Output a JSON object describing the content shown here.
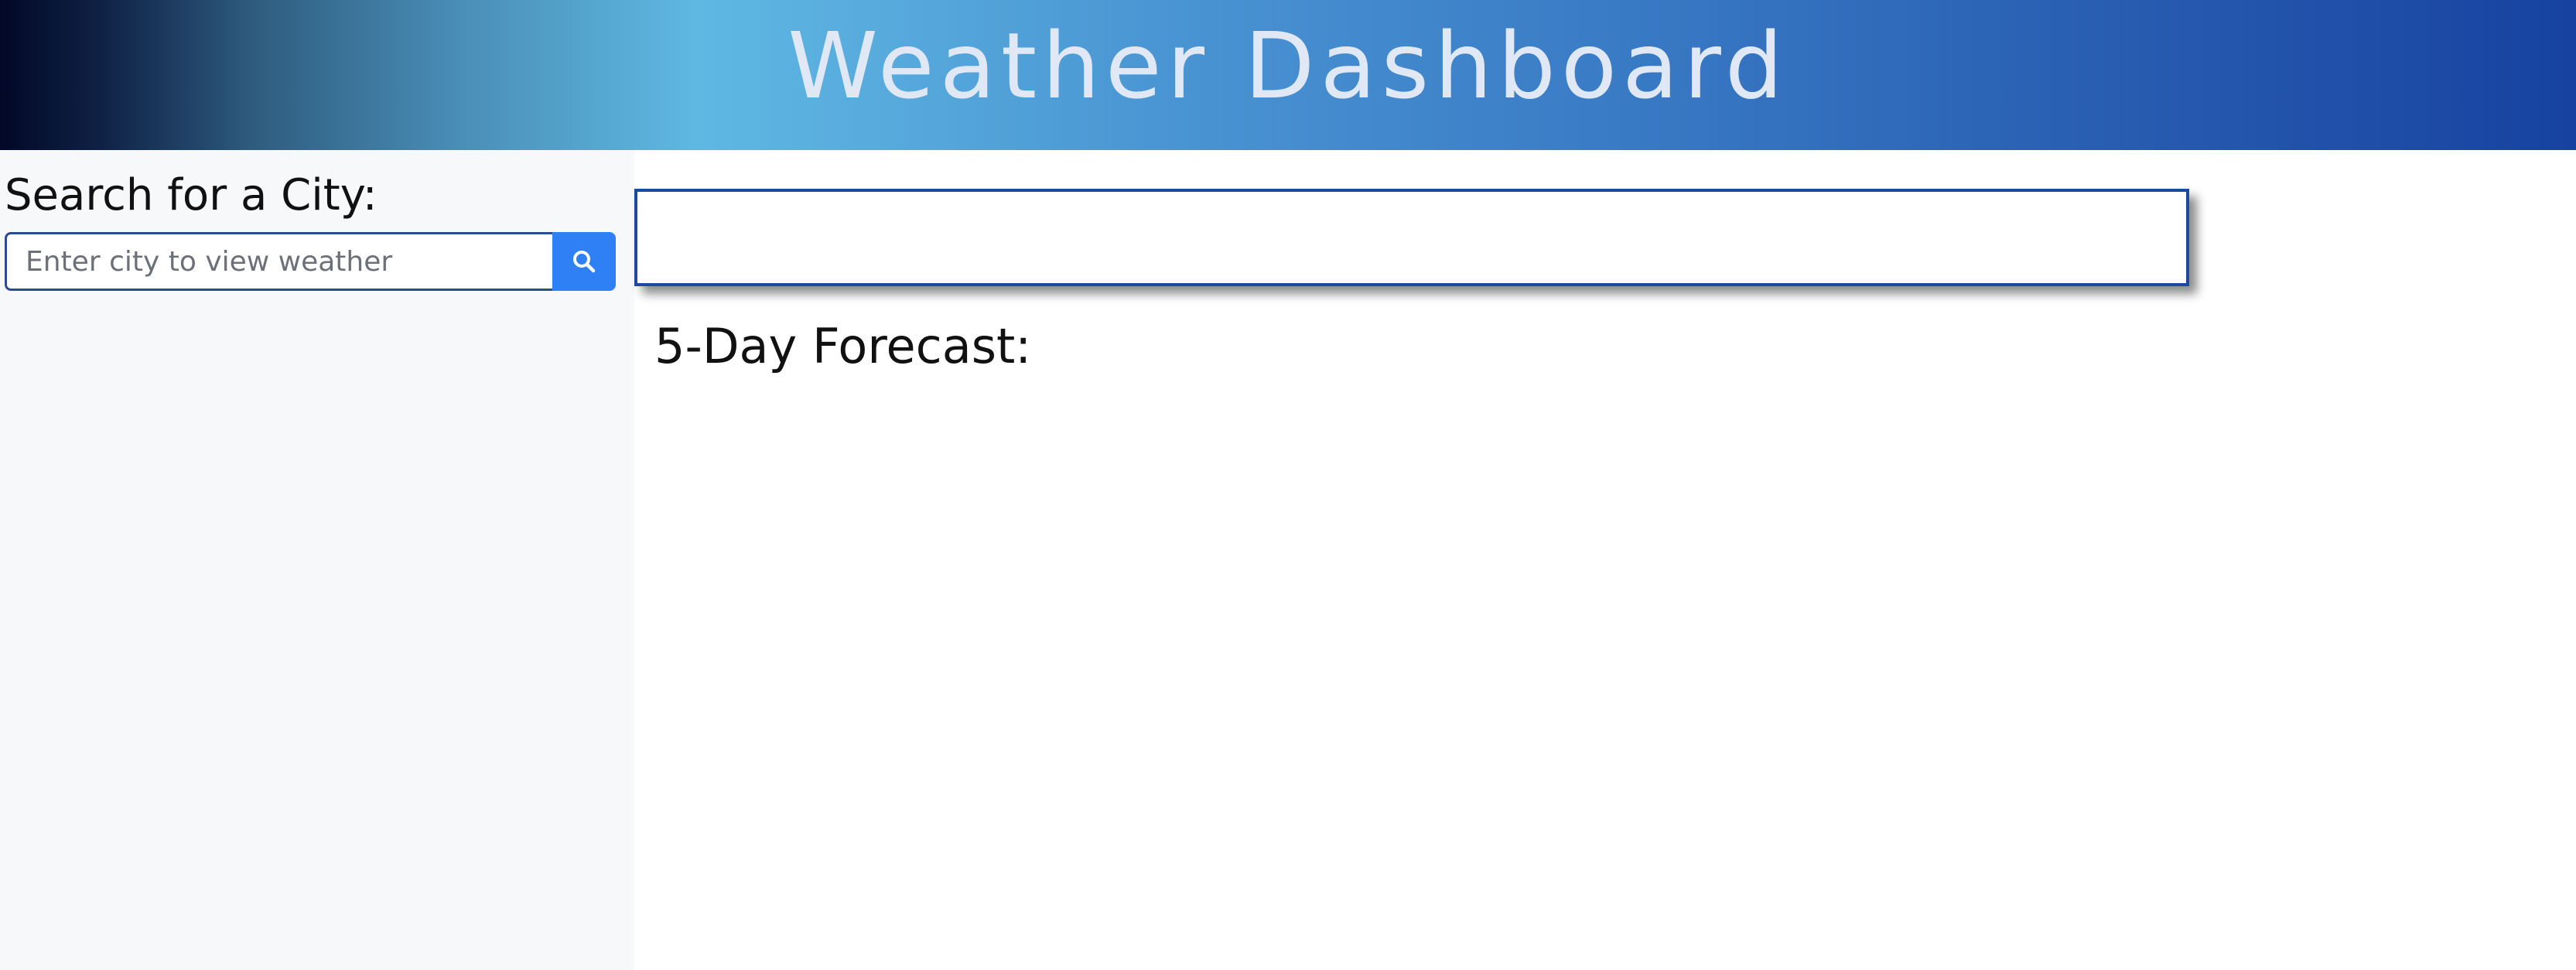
{
  "header": {
    "title": "Weather Dashboard"
  },
  "sidebar": {
    "heading": "Search for a City:",
    "search": {
      "placeholder": "Enter city to view weather",
      "value": "",
      "button_icon": "search-icon"
    }
  },
  "main": {
    "current_weather": "",
    "forecast_heading": "5-Day Forecast:"
  },
  "colors": {
    "header_gradient_start": "#020826",
    "header_gradient_mid": "#5eb8e2",
    "header_gradient_end": "#1742a0",
    "header_text": "#dfe8f4",
    "sidebar_bg": "#f7f8fa",
    "search_button": "#2f7ff5",
    "card_border": "#1c4aa0"
  }
}
